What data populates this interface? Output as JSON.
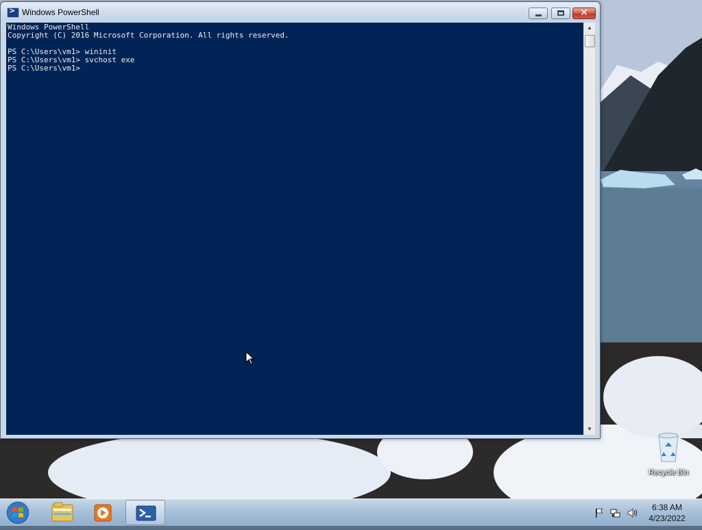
{
  "window": {
    "title": "Windows PowerShell",
    "close_glyph": "✕",
    "console_lines": [
      "Windows PowerShell",
      "Copyright (C) 2016 Microsoft Corporation. All rights reserved.",
      "",
      "PS C:\\Users\\vm1> wininit",
      "PS C:\\Users\\vm1> svchost exe",
      "PS C:\\Users\\vm1>"
    ],
    "console_bg": "#012456",
    "console_fg": "#eeedf0",
    "scroll_up_glyph": "▲",
    "scroll_down_glyph": "▼"
  },
  "desktop": {
    "icons": [
      {
        "label": "Recycle Bin",
        "icon": "recycle-bin-icon"
      }
    ]
  },
  "taskbar": {
    "pinned": [
      "windows-explorer-icon",
      "media-player-icon",
      "powershell-icon"
    ],
    "active": "powershell-icon",
    "clock": {
      "time": "6:38 AM",
      "date": "4/23/2022"
    },
    "tray_icons": [
      "action-center-flag-icon",
      "network-icon",
      "volume-icon"
    ]
  }
}
